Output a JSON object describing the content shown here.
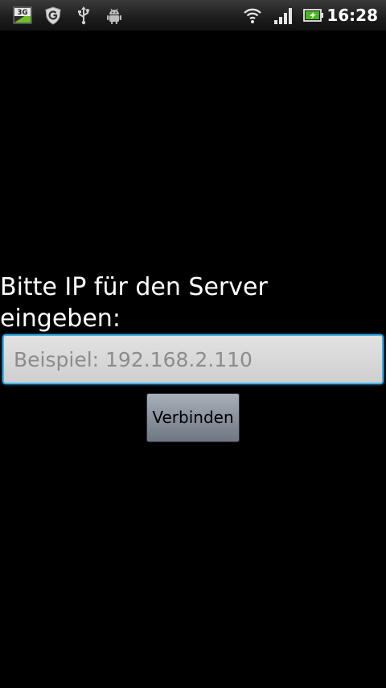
{
  "status_bar": {
    "time": "16:28",
    "network_badge": "3G",
    "left_icons": [
      "3g-data-icon",
      "g-app-icon",
      "usb-icon",
      "android-debug-icon"
    ],
    "right_icons": [
      "wifi-icon",
      "signal-strength-icon",
      "battery-charging-icon"
    ]
  },
  "form": {
    "prompt": "Bitte IP für den Server eingeben:",
    "ip_input": {
      "value": "",
      "placeholder": "Beispiel: 192.168.2.110"
    },
    "connect_button_label": "Verbinden"
  },
  "colors": {
    "background": "#000000",
    "input_focus_border": "#3fb3e6",
    "text": "#ffffff"
  }
}
